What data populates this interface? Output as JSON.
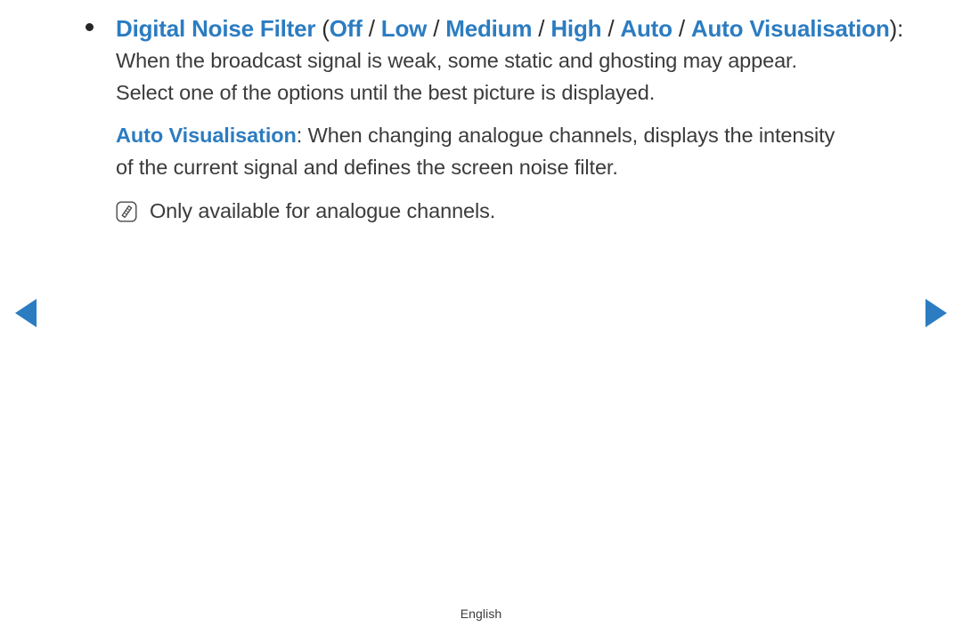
{
  "colors": {
    "accent_blue": "#2c7cc1",
    "body_text": "#3b3b3b",
    "heading_punctuation": "#2e2e2e",
    "background": "#ffffff"
  },
  "bullet": {
    "heading": {
      "title": "Digital Noise Filter",
      "open_paren": " (",
      "options": [
        "Off",
        "Low",
        "Medium",
        "High",
        "Auto",
        "Auto Visualisation"
      ],
      "separator": " / ",
      "close_paren": ")",
      "colon": ":"
    },
    "description_lines": [
      "When the broadcast signal is weak, some static and ghosting may appear.",
      "Select one of the options until the best picture is displayed."
    ],
    "sub_paragraph": {
      "label": "Auto Visualisation",
      "line1_rest": ": When changing analogue channels, displays the intensity",
      "line2": "of the current signal and defines the screen noise filter."
    },
    "note": {
      "icon": "note-pencil-icon",
      "text": "Only available for analogue channels."
    }
  },
  "navigation": {
    "prev_label": "previous-page-arrow",
    "next_label": "next-page-arrow"
  },
  "footer": {
    "language": "English"
  }
}
